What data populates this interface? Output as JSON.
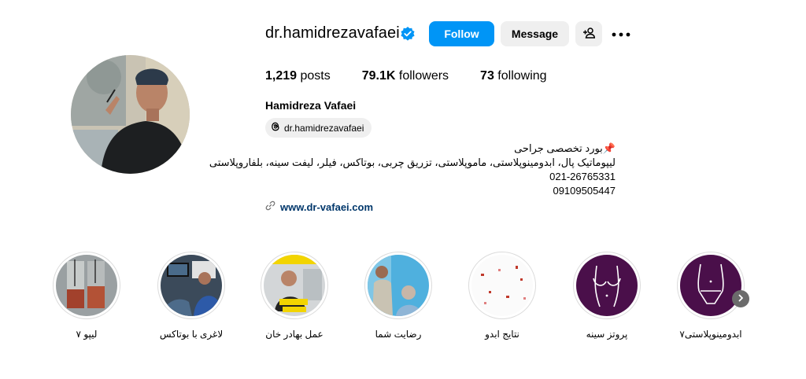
{
  "profile": {
    "username": "dr.hamidrezavafaei",
    "full_name": "Hamidreza Vafaei",
    "threads_handle": "dr.hamidrezavafaei",
    "website": "www.dr-vafaei.com"
  },
  "actions": {
    "follow": "Follow",
    "message": "Message"
  },
  "stats": {
    "posts_count": "1,219",
    "posts_label": "posts",
    "followers_count": "79.1K",
    "followers_label": "followers",
    "following_count": "73",
    "following_label": "following"
  },
  "bio": {
    "line1": "📌بورد تخصصی جراحی",
    "line2": "لیپوماتیک پال، ابدومینوپلاستی، ماموپلاستی، تزریق چربی، بوتاکس، فیلر، لیفت سینه، بلفاروپلاستی",
    "phone1": "021-26765331",
    "phone2": "09109505447"
  },
  "highlights": [
    {
      "label": "لیپو ۷"
    },
    {
      "label": "لاغری با بوتاکس"
    },
    {
      "label": "عمل بهادر خان"
    },
    {
      "label": "رضایت شما"
    },
    {
      "label": "نتایج ابدو"
    },
    {
      "label": "پروتز سینه"
    },
    {
      "label": "ابدومینوپلاستی۷"
    }
  ],
  "colors": {
    "follow_button": "#0095f6",
    "secondary_button": "#efefef",
    "link": "#00376b",
    "highlight_purple": "#4a0f4a",
    "verified": "#0095f6"
  },
  "icons": {
    "verified": "verified-badge-icon",
    "add_user": "add-user-icon",
    "more": "more-options-icon",
    "threads": "threads-icon",
    "link": "link-icon",
    "next": "chevron-right-icon"
  }
}
